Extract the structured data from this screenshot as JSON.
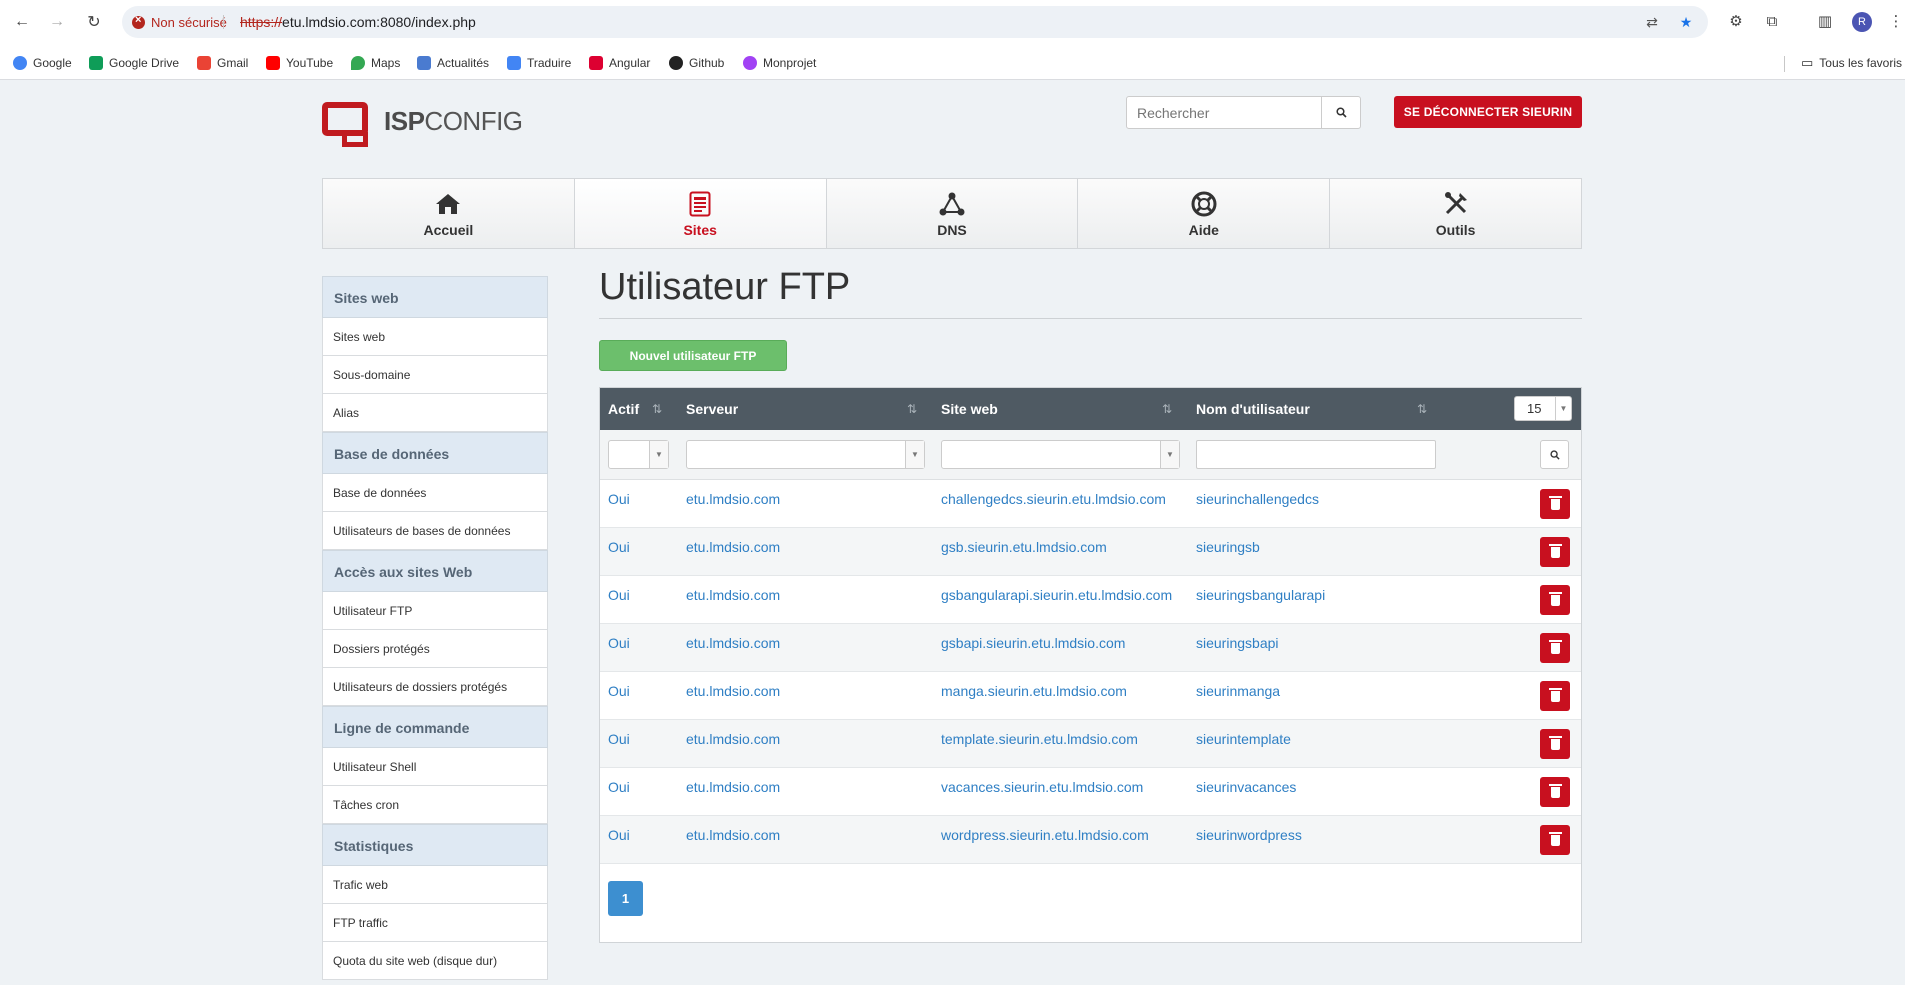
{
  "browser": {
    "security_label": "Non sécurisé",
    "url_scheme": "https://",
    "url_rest": "etu.lmdsio.com:8080/index.php",
    "profile_initial": "R",
    "bookmarks": [
      "Google",
      "Google Drive",
      "Gmail",
      "YouTube",
      "Maps",
      "Actualités",
      "Traduire",
      "Angular",
      "Github",
      "Monprojet"
    ],
    "all_bookmarks_label": "Tous les favoris"
  },
  "header": {
    "logo_bold": "ISP",
    "logo_light": "CONFIG",
    "search_placeholder": "Rechercher",
    "logout_label": "SE DÉCONNECTER SIEURIN"
  },
  "nav": {
    "tabs": [
      {
        "label": "Accueil",
        "icon": "home-icon"
      },
      {
        "label": "Sites",
        "icon": "sites-icon",
        "active": true
      },
      {
        "label": "DNS",
        "icon": "dns-icon"
      },
      {
        "label": "Aide",
        "icon": "help-icon"
      },
      {
        "label": "Outils",
        "icon": "tools-icon"
      }
    ]
  },
  "sidebar": {
    "sections": [
      {
        "title": "Sites web",
        "items": [
          "Sites web",
          "Sous-domaine",
          "Alias"
        ]
      },
      {
        "title": "Base de données",
        "items": [
          "Base de données",
          "Utilisateurs de bases de données"
        ]
      },
      {
        "title": "Accès aux sites Web",
        "items": [
          "Utilisateur FTP",
          "Dossiers protégés",
          "Utilisateurs de dossiers protégés"
        ]
      },
      {
        "title": "Ligne de commande",
        "items": [
          "Utilisateur Shell",
          "Tâches cron"
        ]
      },
      {
        "title": "Statistiques",
        "items": [
          "Trafic web",
          "FTP traffic",
          "Quota du site web (disque dur)"
        ]
      }
    ]
  },
  "main": {
    "title": "Utilisateur FTP",
    "new_button": "Nouvel utilisateur FTP",
    "columns": [
      "Actif",
      "Serveur",
      "Site web",
      "Nom d'utilisateur"
    ],
    "per_page": "15",
    "rows": [
      {
        "actif": "Oui",
        "serveur": "etu.lmdsio.com",
        "site": "challengedcs.sieurin.etu.lmdsio.com",
        "user": "sieurinchallengedcs"
      },
      {
        "actif": "Oui",
        "serveur": "etu.lmdsio.com",
        "site": "gsb.sieurin.etu.lmdsio.com",
        "user": "sieuringsb"
      },
      {
        "actif": "Oui",
        "serveur": "etu.lmdsio.com",
        "site": "gsbangularapi.sieurin.etu.lmdsio.com",
        "user": "sieuringsbangularapi"
      },
      {
        "actif": "Oui",
        "serveur": "etu.lmdsio.com",
        "site": "gsbapi.sieurin.etu.lmdsio.com",
        "user": "sieuringsbapi"
      },
      {
        "actif": "Oui",
        "serveur": "etu.lmdsio.com",
        "site": "manga.sieurin.etu.lmdsio.com",
        "user": "sieurinmanga"
      },
      {
        "actif": "Oui",
        "serveur": "etu.lmdsio.com",
        "site": "template.sieurin.etu.lmdsio.com",
        "user": "sieurintemplate"
      },
      {
        "actif": "Oui",
        "serveur": "etu.lmdsio.com",
        "site": "vacances.sieurin.etu.lmdsio.com",
        "user": "sieurinvacances"
      },
      {
        "actif": "Oui",
        "serveur": "etu.lmdsio.com",
        "site": "wordpress.sieurin.etu.lmdsio.com",
        "user": "sieurinwordpress"
      }
    ],
    "current_page": "1"
  },
  "colors": {
    "brand_red": "#c8101f",
    "link_blue": "#2f7fc4",
    "header_dark": "#4f5a63",
    "success_green": "#6cbf6c"
  }
}
